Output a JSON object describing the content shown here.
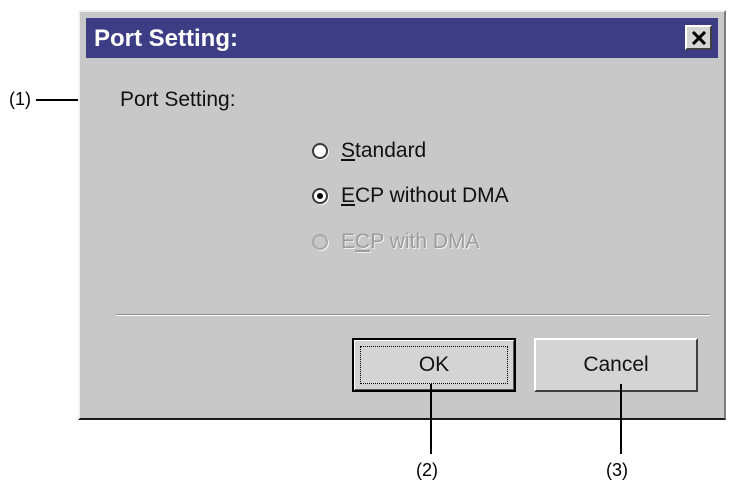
{
  "dialog": {
    "title": "Port Setting:",
    "close_glyph": "✕",
    "group_label": "Port Setting:",
    "options": [
      {
        "pre": "",
        "mnemonic": "S",
        "post": "tandard",
        "checked": false,
        "disabled": false
      },
      {
        "pre": "",
        "mnemonic": "E",
        "post": "CP without DMA",
        "checked": true,
        "disabled": false
      },
      {
        "pre": "E",
        "mnemonic": "C",
        "post": "P with DMA",
        "checked": false,
        "disabled": true
      }
    ],
    "ok_label": "OK",
    "cancel_label": "Cancel"
  },
  "callouts": {
    "one": "(1)",
    "two": "(2)",
    "three": "(3)"
  },
  "colors": {
    "titlebar": "#3d3d86",
    "dialog_bg": "#c8c8c8",
    "disabled_text": "#9c9c9c"
  }
}
